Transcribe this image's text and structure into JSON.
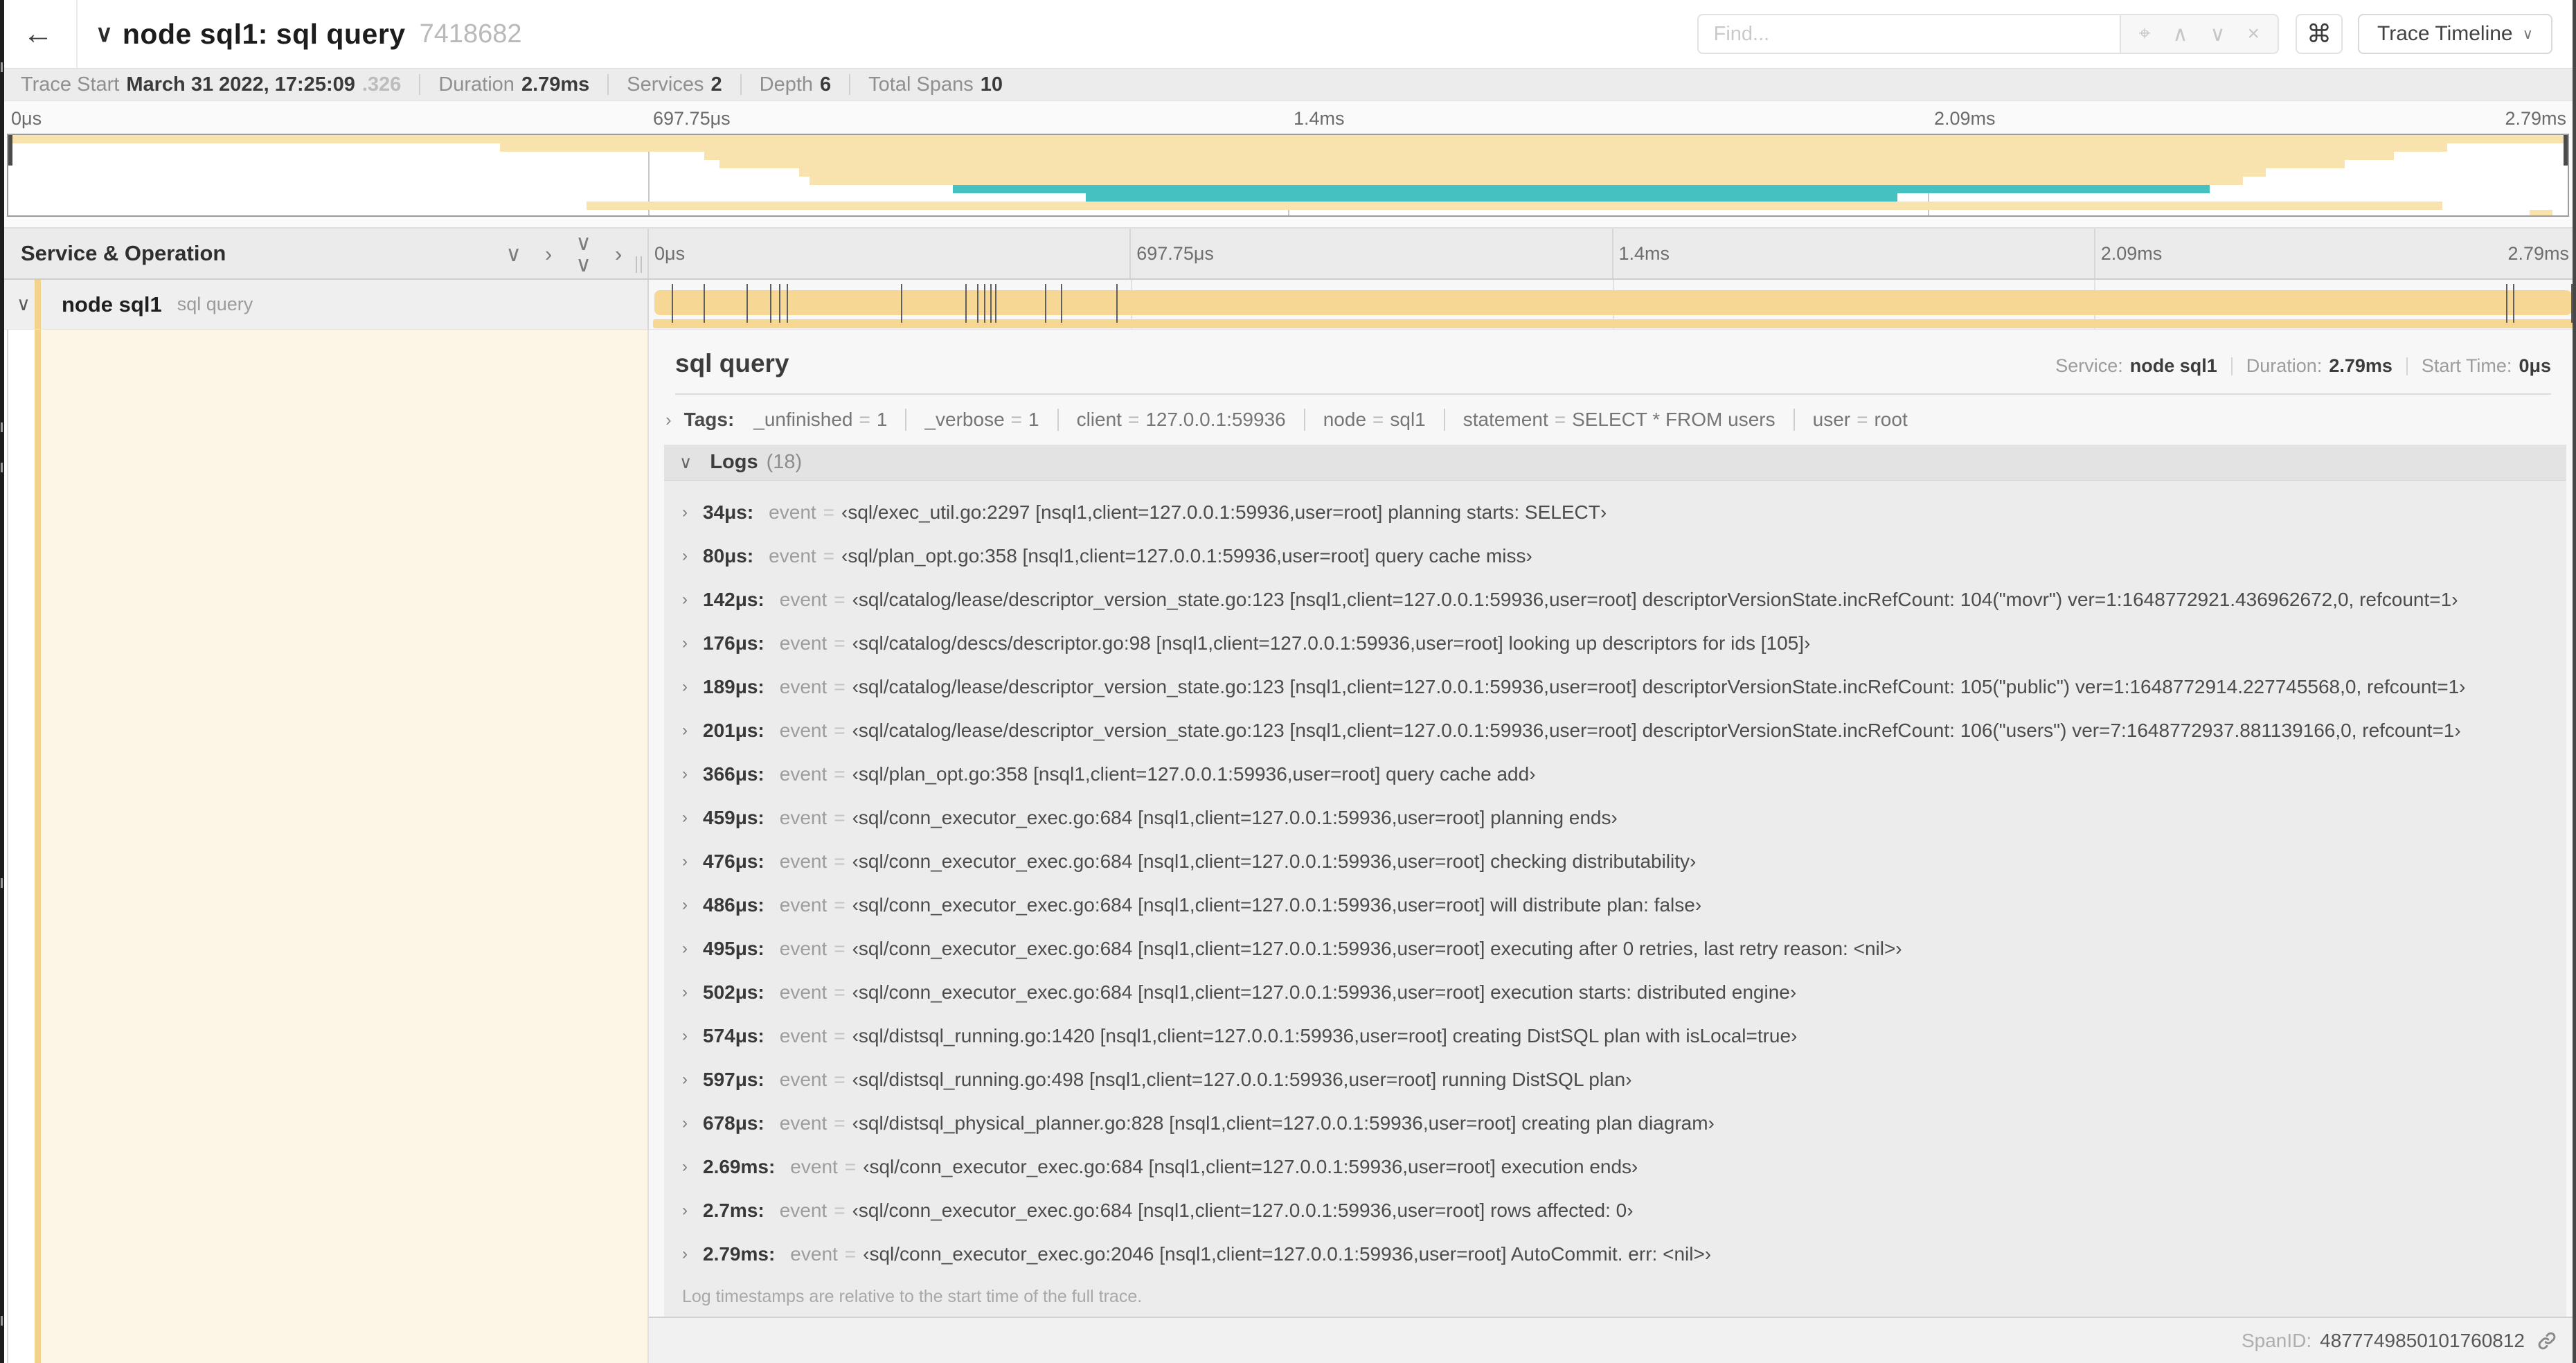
{
  "colors": {
    "orange_bar": "#f6d794",
    "orange_mini": "#f8e3ae",
    "teal": "#45c1c1",
    "accent": "#f3d28b",
    "cream": "#fdf5e6"
  },
  "header": {
    "back_icon": "←",
    "collapse_icon": "∨",
    "title": "node sql1: sql query",
    "trace_id": "7418682",
    "find": {
      "placeholder": "Find..."
    },
    "find_icons": {
      "target": "⌖",
      "prev": "∧",
      "next": "∨",
      "clear": "×"
    },
    "shortcuts_button": "⌘",
    "view_button": {
      "label": "Trace Timeline",
      "chevron": "∨"
    }
  },
  "stats": {
    "trace_start": {
      "label": "Trace Start",
      "value": "March 31 2022, 17:25:09",
      "fraction": ".326"
    },
    "duration": {
      "label": "Duration",
      "value": "2.79ms"
    },
    "services": {
      "label": "Services",
      "value": "2"
    },
    "depth": {
      "label": "Depth",
      "value": "6"
    },
    "total_spans": {
      "label": "Total Spans",
      "value": "10"
    }
  },
  "timeline": {
    "ticks": [
      "0μs",
      "697.75μs",
      "1.4ms",
      "2.09ms",
      "2.79ms"
    ],
    "total_us": 2790
  },
  "minimap": {
    "bars": [
      {
        "row": 0,
        "start": 0,
        "end": 100,
        "color": "orange_mini"
      },
      {
        "row": 1,
        "start": 19.2,
        "end": 95.3,
        "color": "orange_mini"
      },
      {
        "row": 2,
        "start": 27.2,
        "end": 93.2,
        "color": "orange_mini"
      },
      {
        "row": 3,
        "start": 27.8,
        "end": 91.3,
        "color": "orange_mini"
      },
      {
        "row": 4,
        "start": 30.9,
        "end": 88.2,
        "color": "orange_mini"
      },
      {
        "row": 5,
        "start": 31.3,
        "end": 87.3,
        "color": "orange_mini"
      },
      {
        "row": 6,
        "start": 36.9,
        "end": 86.0,
        "color": "teal"
      },
      {
        "row": 7,
        "start": 42.1,
        "end": 73.8,
        "color": "teal"
      },
      {
        "row": 8,
        "start": 22.6,
        "end": 95.1,
        "color": "orange_mini"
      },
      {
        "row": 9,
        "start": 98.5,
        "end": 99.4,
        "color": "orange_mini"
      }
    ]
  },
  "span_table": {
    "header_label": "Service & Operation",
    "icons": {
      "collapse_one": "∨",
      "expand_one": "›",
      "chevron_down": "∨",
      "chevron_right": "›"
    },
    "row": {
      "chevron": "∨",
      "service": "node sql1",
      "operation": "sql query"
    },
    "log_marker_times_us": [
      34,
      80,
      142,
      176,
      189,
      201,
      366,
      459,
      476,
      486,
      495,
      502,
      574,
      597,
      678,
      2690,
      2700,
      2790
    ]
  },
  "detail": {
    "operation": "sql query",
    "meta": {
      "service_label": "Service:",
      "service": "node sql1",
      "duration_label": "Duration:",
      "duration": "2.79ms",
      "start_label": "Start Time:",
      "start": "0μs"
    },
    "tags": {
      "chevron": "›",
      "label": "Tags:",
      "items": [
        {
          "key": "_unfinished",
          "value": "1"
        },
        {
          "key": "_verbose",
          "value": "1"
        },
        {
          "key": "client",
          "value": "127.0.0.1:59936"
        },
        {
          "key": "node",
          "value": "sql1"
        },
        {
          "key": "statement",
          "value": "SELECT * FROM users"
        },
        {
          "key": "user",
          "value": "root"
        }
      ]
    },
    "logs": {
      "chevron": "∨",
      "label": "Logs",
      "count": "(18)",
      "entry_key": "event",
      "entries": [
        {
          "time": "34μs:",
          "value": "‹sql/exec_util.go:2297 [nsql1,client=127.0.0.1:59936,user=root] planning starts: SELECT›"
        },
        {
          "time": "80μs:",
          "value": "‹sql/plan_opt.go:358 [nsql1,client=127.0.0.1:59936,user=root] query cache miss›"
        },
        {
          "time": "142μs:",
          "value": "‹sql/catalog/lease/descriptor_version_state.go:123 [nsql1,client=127.0.0.1:59936,user=root] descriptorVersionState.incRefCount: 104(\"movr\") ver=1:1648772921.436962672,0, refcount=1›"
        },
        {
          "time": "176μs:",
          "value": "‹sql/catalog/descs/descriptor.go:98 [nsql1,client=127.0.0.1:59936,user=root] looking up descriptors for ids [105]›"
        },
        {
          "time": "189μs:",
          "value": "‹sql/catalog/lease/descriptor_version_state.go:123 [nsql1,client=127.0.0.1:59936,user=root] descriptorVersionState.incRefCount: 105(\"public\") ver=1:1648772914.227745568,0, refcount=1›"
        },
        {
          "time": "201μs:",
          "value": "‹sql/catalog/lease/descriptor_version_state.go:123 [nsql1,client=127.0.0.1:59936,user=root] descriptorVersionState.incRefCount: 106(\"users\") ver=7:1648772937.881139166,0, refcount=1›"
        },
        {
          "time": "366μs:",
          "value": "‹sql/plan_opt.go:358 [nsql1,client=127.0.0.1:59936,user=root] query cache add›"
        },
        {
          "time": "459μs:",
          "value": "‹sql/conn_executor_exec.go:684 [nsql1,client=127.0.0.1:59936,user=root] planning ends›"
        },
        {
          "time": "476μs:",
          "value": "‹sql/conn_executor_exec.go:684 [nsql1,client=127.0.0.1:59936,user=root] checking distributability›"
        },
        {
          "time": "486μs:",
          "value": "‹sql/conn_executor_exec.go:684 [nsql1,client=127.0.0.1:59936,user=root] will distribute plan: false›"
        },
        {
          "time": "495μs:",
          "value": "‹sql/conn_executor_exec.go:684 [nsql1,client=127.0.0.1:59936,user=root] executing after 0 retries, last retry reason: <nil>›"
        },
        {
          "time": "502μs:",
          "value": "‹sql/conn_executor_exec.go:684 [nsql1,client=127.0.0.1:59936,user=root] execution starts: distributed engine›"
        },
        {
          "time": "574μs:",
          "value": "‹sql/distsql_running.go:1420 [nsql1,client=127.0.0.1:59936,user=root] creating DistSQL plan with isLocal=true›"
        },
        {
          "time": "597μs:",
          "value": "‹sql/distsql_running.go:498 [nsql1,client=127.0.0.1:59936,user=root] running DistSQL plan›"
        },
        {
          "time": "678μs:",
          "value": "‹sql/distsql_physical_planner.go:828 [nsql1,client=127.0.0.1:59936,user=root] creating plan diagram›"
        },
        {
          "time": "2.69ms:",
          "value": "‹sql/conn_executor_exec.go:684 [nsql1,client=127.0.0.1:59936,user=root] execution ends›"
        },
        {
          "time": "2.7ms:",
          "value": "‹sql/conn_executor_exec.go:684 [nsql1,client=127.0.0.1:59936,user=root] rows affected: 0›"
        },
        {
          "time": "2.79ms:",
          "value": "‹sql/conn_executor_exec.go:2046 [nsql1,client=127.0.0.1:59936,user=root] AutoCommit. err: <nil>›"
        }
      ],
      "footer": "Log timestamps are relative to the start time of the full trace."
    },
    "span_id_label": "SpanID:",
    "span_id": "4877749850101760812"
  }
}
